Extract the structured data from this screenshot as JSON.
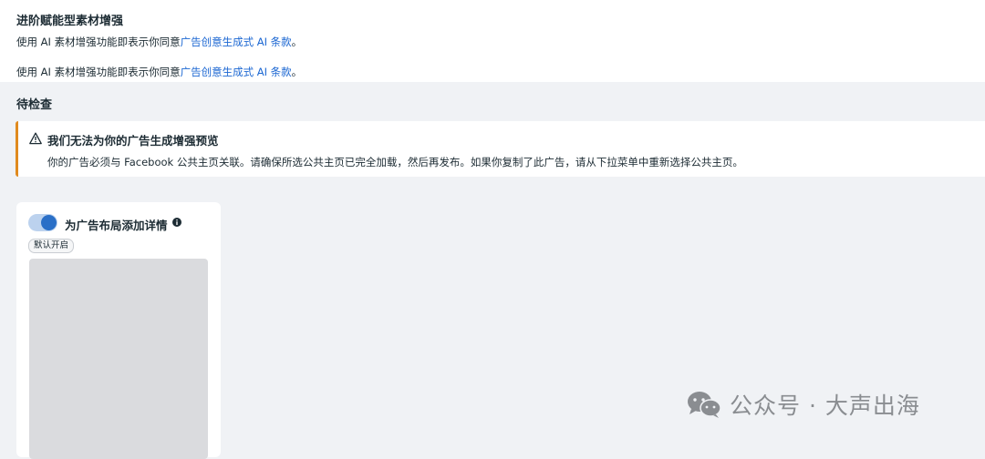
{
  "advanced": {
    "title": "进阶赋能型素材增强",
    "consent_prefix": "使用 AI 素材增强功能即表示你同意",
    "consent_link": "广告创意生成式 AI 条款",
    "consent_suffix": "。"
  },
  "pending": {
    "title": "待检查"
  },
  "alert": {
    "icon": "warning-icon",
    "title": "我们无法为你的广告生成增强预览",
    "body": "你的广告必须与 Facebook 公共主页关联。请确保所选公共主页已完全加载，然后再发布。如果你复制了此广告，请从下拉菜单中重新选择公共主页。",
    "accent_color": "#e08a1e"
  },
  "card": {
    "toggle_label": "为广告布局添加详情",
    "toggle_on": true,
    "default_badge": "默认开启",
    "info_icon": "info-icon"
  },
  "watermark": {
    "icon": "wechat-icon",
    "text": "公众号 · 大声出海"
  },
  "colors": {
    "link": "#1a66d2",
    "toggle": "#2a6fc7"
  }
}
